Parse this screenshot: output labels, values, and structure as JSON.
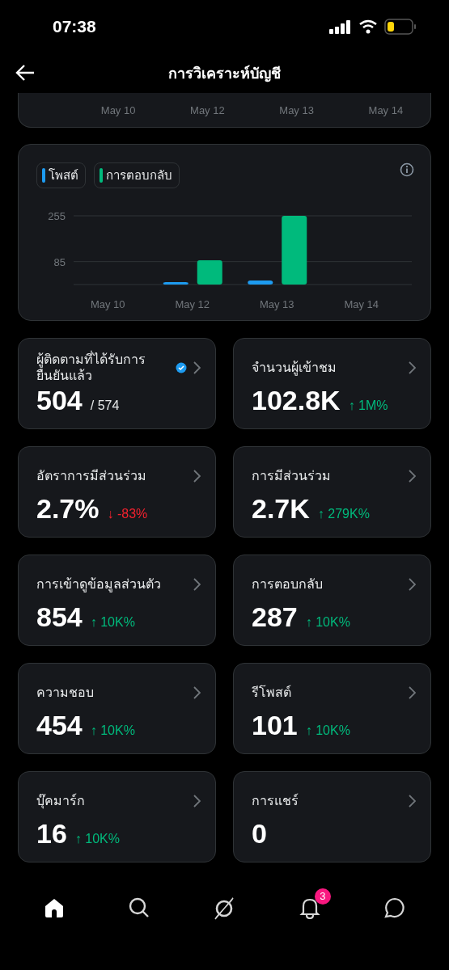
{
  "status_bar": {
    "time": "07:38"
  },
  "header": {
    "title": "การวิเคราะห์บัญชี"
  },
  "top_chart_axis": [
    "May 10",
    "May 12",
    "May 13",
    "May 14"
  ],
  "chart": {
    "chart_data": {
      "type": "bar",
      "categories": [
        "May 10",
        "May 12",
        "May 13",
        "May 14"
      ],
      "yticks": [
        85,
        255
      ],
      "ylim": [
        0,
        255
      ],
      "series": [
        {
          "name": "โพสต์",
          "color": "#1d9bf0",
          "values": [
            0,
            9,
            15,
            0
          ]
        },
        {
          "name": "การตอบกลับ",
          "color": "#00ba7c",
          "values": [
            0,
            90,
            255,
            0
          ]
        }
      ]
    }
  },
  "stats": [
    {
      "label": "ผู้ติดตามที่ได้รับการยืนยันแล้ว",
      "value": "504",
      "total": "/ 574",
      "verified": true
    },
    {
      "label": "จำนวนผู้เข้าชม",
      "value": "102.8K",
      "change": "↑ 1M%",
      "color": "#00ba7c"
    },
    {
      "label": "อัตราการมีส่วนร่วม",
      "value": "2.7%",
      "change": "↓ -83%",
      "color": "#f4212e"
    },
    {
      "label": "การมีส่วนร่วม",
      "value": "2.7K",
      "change": "↑ 279K%",
      "color": "#00ba7c"
    },
    {
      "label": "การเข้าดูข้อมูลส่วนตัว",
      "value": "854",
      "change": "↑ 10K%",
      "color": "#00ba7c"
    },
    {
      "label": "การตอบกลับ",
      "value": "287",
      "change": "↑ 10K%",
      "color": "#00ba7c"
    },
    {
      "label": "ความชอบ",
      "value": "454",
      "change": "↑ 10K%",
      "color": "#00ba7c"
    },
    {
      "label": "รีโพสต์",
      "value": "101",
      "change": "↑ 10K%",
      "color": "#00ba7c"
    },
    {
      "label": "บุ๊คมาร์ก",
      "value": "16",
      "change": "↑ 10K%",
      "color": "#00ba7c"
    },
    {
      "label": "การแชร์",
      "value": "0"
    }
  ],
  "tab_bar": [
    {
      "kind": "home",
      "selected": true
    },
    {
      "kind": "search",
      "selected": false
    },
    {
      "kind": "grok",
      "selected": false
    },
    {
      "kind": "bell",
      "selected": false,
      "badge": "3"
    },
    {
      "kind": "chat",
      "selected": false
    }
  ]
}
